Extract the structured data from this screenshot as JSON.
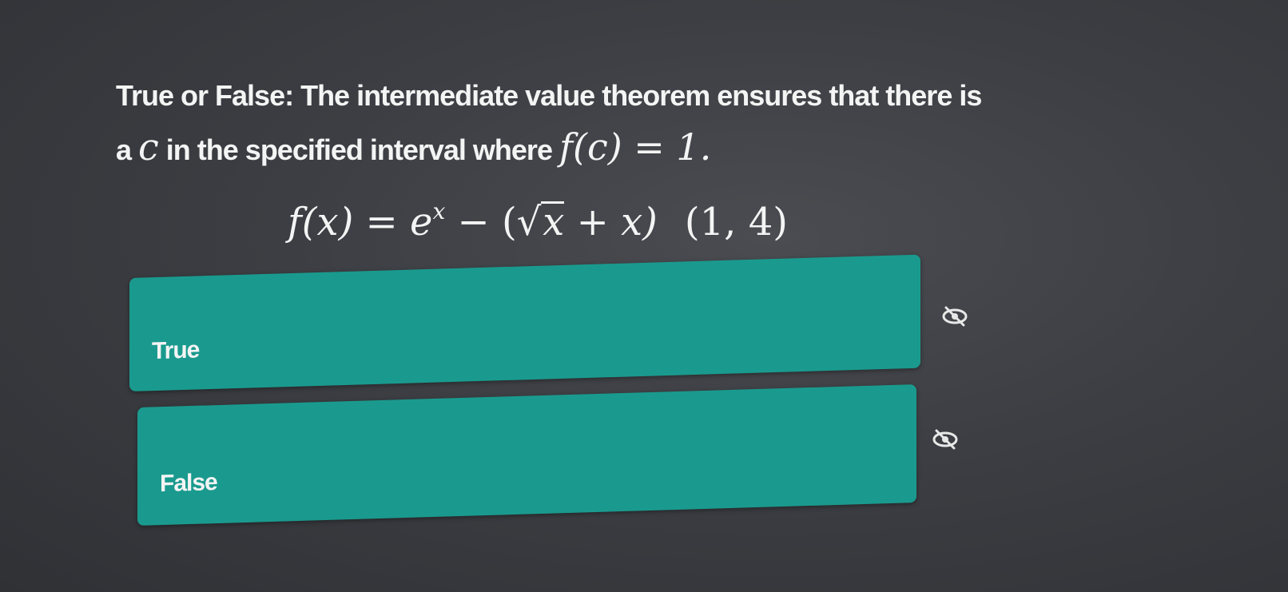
{
  "question": {
    "text_part1": "True or False: The intermediate value theorem ensures that there is a ",
    "variable": "c",
    "text_part2": " in the specified interval where ",
    "condition": "f(c) = 1."
  },
  "formula": {
    "lhs": "f(x) = e",
    "exponent": "x",
    "minus_open": " − (",
    "radicand": "x",
    "rest": " + x)",
    "interval": "(1, 4)"
  },
  "options": [
    {
      "label": "True",
      "icon": "eye-slash-icon"
    },
    {
      "label": "False",
      "icon": "eye-slash-icon"
    }
  ],
  "colors": {
    "option_bg": "#1a9a8e",
    "background": "#3c3e43",
    "text": "#f4f4f4"
  }
}
